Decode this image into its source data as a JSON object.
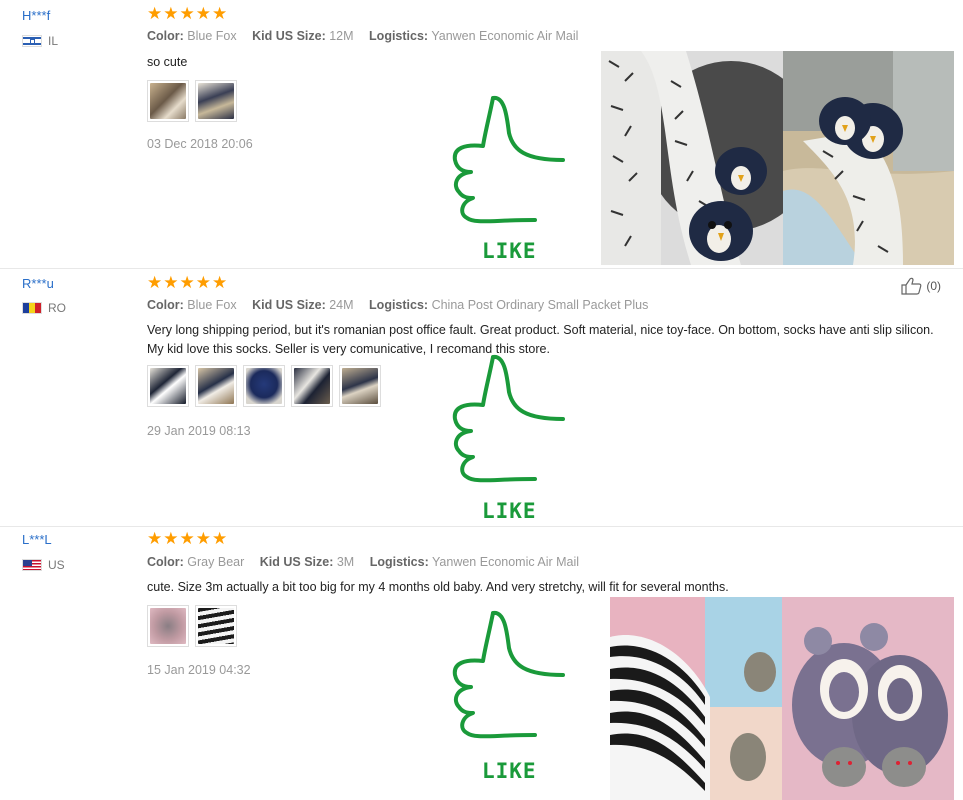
{
  "reviews": [
    {
      "user": "H***f",
      "country": "IL",
      "rating": 5,
      "color_label": "Color:",
      "color": "Blue Fox",
      "size_label": "Kid US Size:",
      "size": "12M",
      "logistics_label": "Logistics:",
      "logistics": "Yanwen Economic Air Mail",
      "text": "so cute",
      "thumbs": 2,
      "date": "03 Dec 2018 20:06",
      "like_label": "LIKE"
    },
    {
      "user": "R***u",
      "country": "RO",
      "rating": 5,
      "color_label": "Color:",
      "color": "Blue Fox",
      "size_label": "Kid US Size:",
      "size": "24M",
      "logistics_label": "Logistics:",
      "logistics": "China Post Ordinary Small Packet Plus",
      "text": "Very long shipping period, but it's romanian post office fault. Great product. Soft material, nice toy-face. On bottom, socks have anti slip silicon. My kid love this socks. Seller is very comunicative, I recomand this store.",
      "thumbs": 5,
      "date": "29 Jan 2019 08:13",
      "helpful_count": "(0)",
      "like_label": "LIKE"
    },
    {
      "user": "L***L",
      "country": "US",
      "rating": 5,
      "color_label": "Color:",
      "color": "Gray Bear",
      "size_label": "Kid US Size:",
      "size": "3M",
      "logistics_label": "Logistics:",
      "logistics": "Yanwen Economic Air Mail",
      "text": "cute. Size 3m actually a bit too big for my 4 months old baby. And very stretchy, will fit for several months.",
      "thumbs": 2,
      "date": "15 Jan 2019 04:32",
      "like_label": "LIKE"
    }
  ],
  "colors": {
    "username": "#2a6fc9",
    "stars": "#ff9d00",
    "like_green": "#1a9a3a"
  }
}
